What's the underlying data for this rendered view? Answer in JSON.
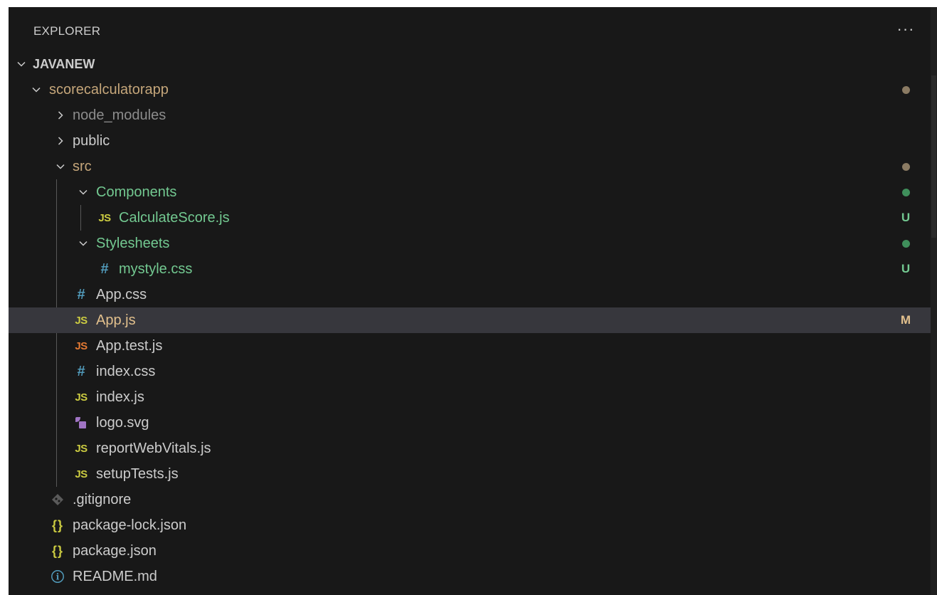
{
  "explorer": {
    "title": "EXPLORER",
    "more_actions_label": "···"
  },
  "colors": {
    "background": "#181818",
    "selected_row": "#37373d",
    "modified_folder": "#c5a67a",
    "untracked": "#73c991",
    "ignored": "#8c8c8c",
    "default_text": "#cccccc",
    "js_icon": "#cbcb41",
    "css_icon": "#519aba",
    "test_js_icon": "#e37933",
    "svg_icon": "#a074c4",
    "dot_modified": "#8b7b63",
    "dot_untracked": "#3f8f5b"
  },
  "tree": {
    "root": {
      "label": "JAVANEW",
      "icon": "chevron-down-icon"
    },
    "items": [
      {
        "label": "scorecalculatorapp",
        "icon": "chevron-down-icon",
        "badge": ""
      },
      {
        "label": "node_modules",
        "icon": "chevron-right-icon",
        "badge": ""
      },
      {
        "label": "public",
        "icon": "chevron-right-icon",
        "badge": ""
      },
      {
        "label": "src",
        "icon": "chevron-down-icon",
        "badge": ""
      },
      {
        "label": "Components",
        "icon": "chevron-down-icon",
        "badge": ""
      },
      {
        "label": "CalculateScore.js",
        "icon": "js-file-icon",
        "icon_text": "JS",
        "badge": "U"
      },
      {
        "label": "Stylesheets",
        "icon": "chevron-down-icon",
        "badge": ""
      },
      {
        "label": "mystyle.css",
        "icon": "css-file-icon",
        "icon_text": "#",
        "badge": "U"
      },
      {
        "label": "App.css",
        "icon": "css-file-icon",
        "icon_text": "#",
        "badge": ""
      },
      {
        "label": "App.js",
        "icon": "js-file-icon",
        "icon_text": "JS",
        "badge": "M",
        "selected": true
      },
      {
        "label": "App.test.js",
        "icon": "test-js-file-icon",
        "icon_text": "JS",
        "badge": ""
      },
      {
        "label": "index.css",
        "icon": "css-file-icon",
        "icon_text": "#",
        "badge": ""
      },
      {
        "label": "index.js",
        "icon": "js-file-icon",
        "icon_text": "JS",
        "badge": ""
      },
      {
        "label": "logo.svg",
        "icon": "svg-file-icon",
        "badge": ""
      },
      {
        "label": "reportWebVitals.js",
        "icon": "js-file-icon",
        "icon_text": "JS",
        "badge": ""
      },
      {
        "label": "setupTests.js",
        "icon": "js-file-icon",
        "icon_text": "JS",
        "badge": ""
      },
      {
        "label": ".gitignore",
        "icon": "git-file-icon",
        "badge": ""
      },
      {
        "label": "package-lock.json",
        "icon": "json-file-icon",
        "icon_text": "{}",
        "badge": ""
      },
      {
        "label": "package.json",
        "icon": "json-file-icon",
        "icon_text": "{}",
        "badge": ""
      },
      {
        "label": "README.md",
        "icon": "info-icon",
        "icon_text": "i",
        "badge": ""
      }
    ]
  }
}
